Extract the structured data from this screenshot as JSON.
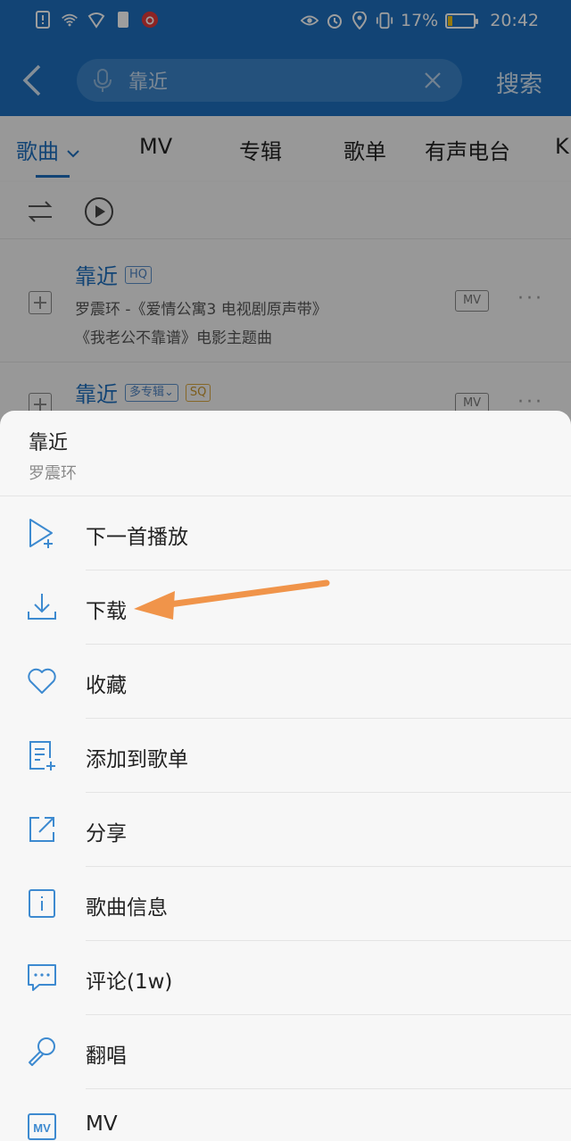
{
  "status_bar": {
    "battery_percent": "17%",
    "battery_level": 0.17,
    "time": "20:42"
  },
  "nav": {
    "search_query": "靠近",
    "search_button": "搜索"
  },
  "tabs": [
    "歌曲",
    "MV",
    "专辑",
    "歌单",
    "有声电台",
    "K"
  ],
  "songs": [
    {
      "title": "靠近",
      "tags": [
        "HQ"
      ],
      "line1": "罗震环 -《爱情公寓3 电视剧原声带》",
      "line2": "《我老公不靠谱》电影主题曲",
      "mv": "MV",
      "more": "···"
    },
    {
      "title": "靠近",
      "tags": [
        "多专辑",
        "SQ"
      ],
      "mv": "MV",
      "more": "···"
    }
  ],
  "sheet": {
    "title": "靠近",
    "artist": "罗震环",
    "items": [
      {
        "label": "下一首播放",
        "icon": "play-next-icon"
      },
      {
        "label": "下载",
        "icon": "download-icon"
      },
      {
        "label": "收藏",
        "icon": "heart-icon"
      },
      {
        "label": "添加到歌单",
        "icon": "add-to-playlist-icon"
      },
      {
        "label": "分享",
        "icon": "share-icon"
      },
      {
        "label": "歌曲信息",
        "icon": "info-icon"
      },
      {
        "label": "评论(1w)",
        "icon": "comment-icon"
      },
      {
        "label": "翻唱",
        "icon": "microphone-icon"
      },
      {
        "label": "MV",
        "icon": "mv-icon"
      }
    ]
  },
  "colors": {
    "brand_blue": "#1d6fbd",
    "icon_blue": "#3d8ad0",
    "annotation_arrow": "#f0944a"
  }
}
